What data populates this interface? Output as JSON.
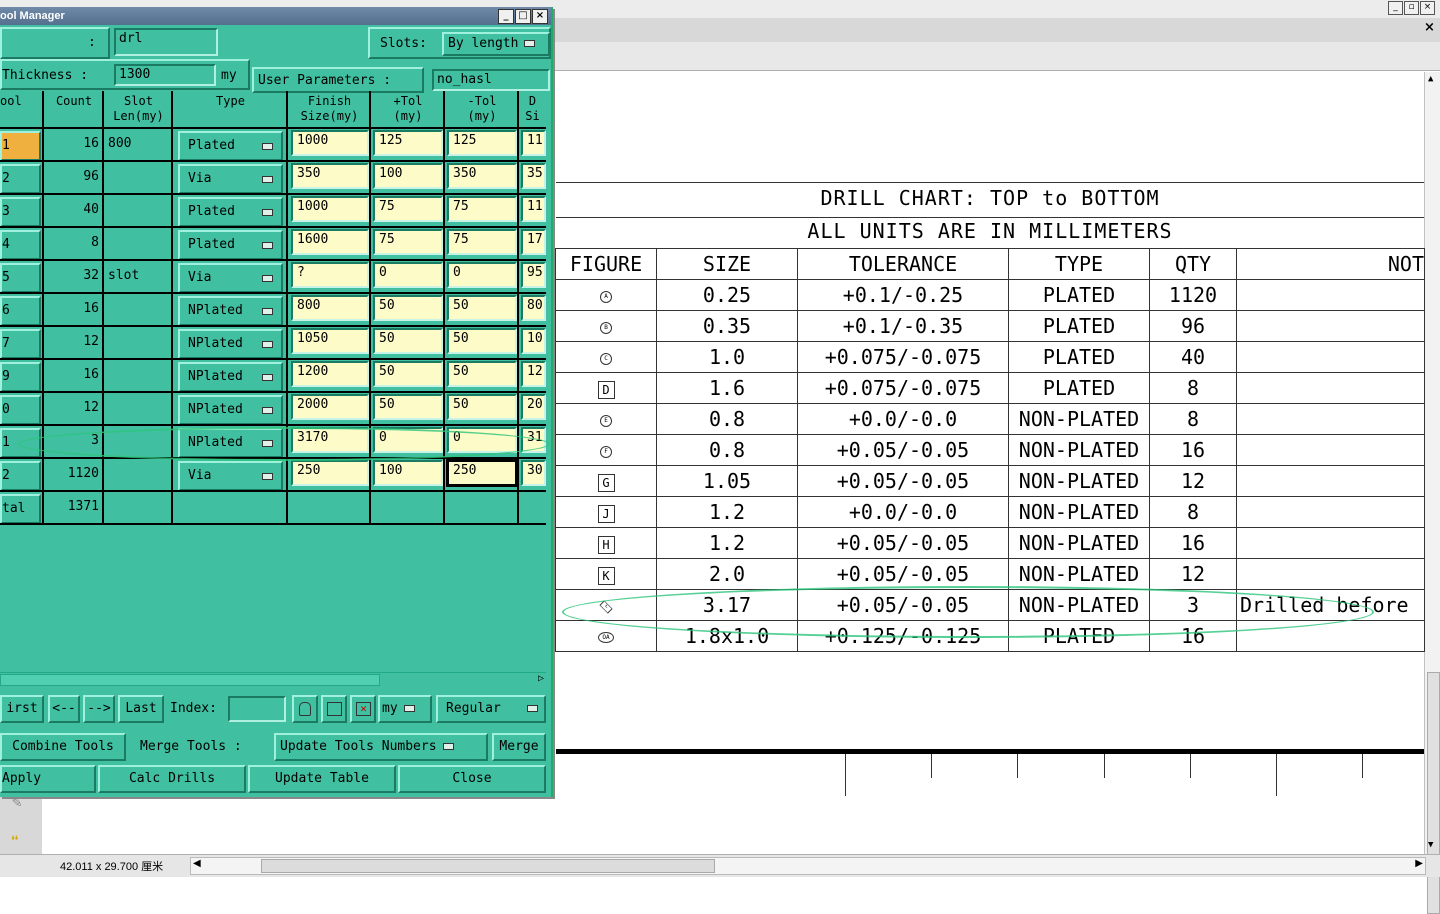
{
  "viewer": {
    "status_page_size": "42.011 x 29.700 厘米",
    "close_symbol": "×",
    "win_min": "_",
    "win_max": "□",
    "win_restore": "▫"
  },
  "drill_chart": {
    "title": "DRILL CHART: TOP to BOTTOM",
    "subtitle": "ALL UNITS ARE IN MILLIMETERS",
    "headers": [
      "FIGURE",
      "SIZE",
      "TOLERANCE",
      "TYPE",
      "QTY",
      "NOT"
    ],
    "rows": [
      {
        "figure": "A",
        "figure_shape": "circle",
        "size": "0.25",
        "tolerance": "+0.1/-0.25",
        "type": "PLATED",
        "qty": "1120",
        "notes": ""
      },
      {
        "figure": "B",
        "figure_shape": "circle",
        "size": "0.35",
        "tolerance": "+0.1/-0.35",
        "type": "PLATED",
        "qty": "96",
        "notes": ""
      },
      {
        "figure": "C",
        "figure_shape": "circle",
        "size": "1.0",
        "tolerance": "+0.075/-0.075",
        "type": "PLATED",
        "qty": "40",
        "notes": ""
      },
      {
        "figure": "D",
        "figure_shape": "box",
        "size": "1.6",
        "tolerance": "+0.075/-0.075",
        "type": "PLATED",
        "qty": "8",
        "notes": ""
      },
      {
        "figure": "E",
        "figure_shape": "circle",
        "size": "0.8",
        "tolerance": "+0.0/-0.0",
        "type": "NON-PLATED",
        "qty": "8",
        "notes": ""
      },
      {
        "figure": "F",
        "figure_shape": "circle",
        "size": "0.8",
        "tolerance": "+0.05/-0.05",
        "type": "NON-PLATED",
        "qty": "16",
        "notes": ""
      },
      {
        "figure": "G",
        "figure_shape": "box",
        "size": "1.05",
        "tolerance": "+0.05/-0.05",
        "type": "NON-PLATED",
        "qty": "12",
        "notes": ""
      },
      {
        "figure": "J",
        "figure_shape": "box",
        "size": "1.2",
        "tolerance": "+0.0/-0.0",
        "type": "NON-PLATED",
        "qty": "8",
        "notes": ""
      },
      {
        "figure": "H",
        "figure_shape": "box",
        "size": "1.2",
        "tolerance": "+0.05/-0.05",
        "type": "NON-PLATED",
        "qty": "16",
        "notes": ""
      },
      {
        "figure": "K",
        "figure_shape": "box",
        "size": "2.0",
        "tolerance": "+0.05/-0.05",
        "type": "NON-PLATED",
        "qty": "12",
        "notes": ""
      },
      {
        "figure": "L",
        "figure_shape": "diamond",
        "size": "3.17",
        "tolerance": "+0.05/-0.05",
        "type": "NON-PLATED",
        "qty": "3",
        "notes": "Drilled before"
      },
      {
        "figure": "OA",
        "figure_shape": "oval",
        "size": "1.8x1.0",
        "tolerance": "+0.125/-0.125",
        "type": "PLATED",
        "qty": "16",
        "notes": ""
      }
    ]
  },
  "tool_manager": {
    "title": "ool Manager",
    "row1": {
      "left_label": ":",
      "ext_value": "drl",
      "slots_label": "Slots:",
      "slots_value": "By length"
    },
    "row2": {
      "thickness_label": "Thickness :",
      "thickness_value": "1300",
      "thickness_unit": "my",
      "user_params_label": "User Parameters :",
      "user_params_value": "no_hasl"
    },
    "columns": [
      "ool",
      "Count",
      "Slot\nLen(my)",
      "Type",
      "Finish\nSize(my)",
      "+Tol\n(my)",
      "-Tol\n(my)",
      "D\nSi"
    ],
    "rows": [
      {
        "tool": "1",
        "count": "16",
        "slot": "800",
        "type": "Plated",
        "finish": "1000",
        "ptol": "125",
        "ntol": "125",
        "dsize": "11"
      },
      {
        "tool": "2",
        "count": "96",
        "slot": "",
        "type": "Via",
        "finish": "350",
        "ptol": "100",
        "ntol": "350",
        "dsize": "35"
      },
      {
        "tool": "3",
        "count": "40",
        "slot": "",
        "type": "Plated",
        "finish": "1000",
        "ptol": "75",
        "ntol": "75",
        "dsize": "11"
      },
      {
        "tool": "4",
        "count": "8",
        "slot": "",
        "type": "Plated",
        "finish": "1600",
        "ptol": "75",
        "ntol": "75",
        "dsize": "17"
      },
      {
        "tool": "5",
        "count": "32",
        "slot": "slot",
        "type": "Via",
        "finish": "?",
        "ptol": "0",
        "ntol": "0",
        "dsize": "95"
      },
      {
        "tool": "6",
        "count": "16",
        "slot": "",
        "type": "NPlated",
        "finish": "800",
        "ptol": "50",
        "ntol": "50",
        "dsize": "80"
      },
      {
        "tool": "7",
        "count": "12",
        "slot": "",
        "type": "NPlated",
        "finish": "1050",
        "ptol": "50",
        "ntol": "50",
        "dsize": "10"
      },
      {
        "tool": "9",
        "count": "16",
        "slot": "",
        "type": "NPlated",
        "finish": "1200",
        "ptol": "50",
        "ntol": "50",
        "dsize": "12"
      },
      {
        "tool": "0",
        "count": "12",
        "slot": "",
        "type": "NPlated",
        "finish": "2000",
        "ptol": "50",
        "ntol": "50",
        "dsize": "20"
      },
      {
        "tool": "1",
        "count": "3",
        "slot": "",
        "type": "NPlated",
        "finish": "3170",
        "ptol": "0",
        "ntol": "0",
        "dsize": "31"
      },
      {
        "tool": "2",
        "count": "1120",
        "slot": "",
        "type": "Via",
        "finish": "250",
        "ptol": "100",
        "ntol": "250",
        "dsize": "30"
      }
    ],
    "total": {
      "label": "tal",
      "count": "1371"
    },
    "nav": {
      "first": "irst",
      "prev": "<--",
      "next": "-->",
      "last": "Last",
      "index_label": "Index:",
      "index_value": "",
      "unit_value": "my",
      "mode_value": "Regular"
    },
    "actions": {
      "combine": "Combine Tools",
      "merge_label": "Merge Tools :",
      "merge_mode": "Update Tools Numbers",
      "merge": "Merge",
      "apply": "Apply",
      "calc": "Calc Drills",
      "update_table": "Update Table",
      "close": "Close"
    }
  }
}
